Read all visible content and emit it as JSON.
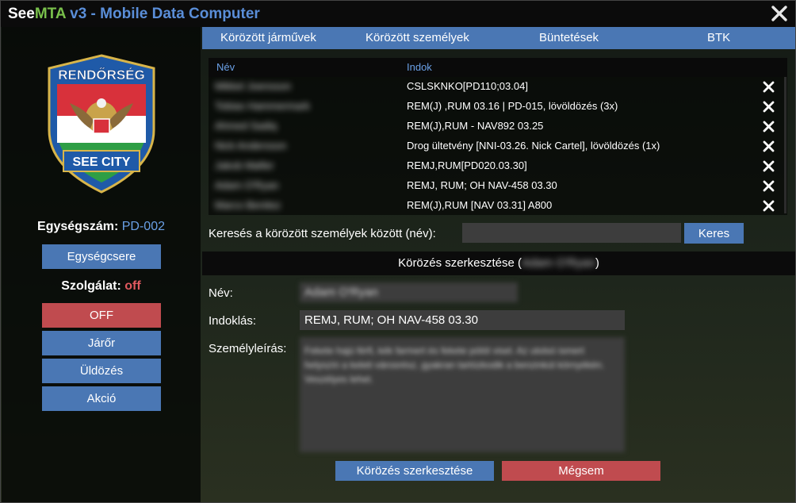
{
  "window": {
    "title_part1": "See",
    "title_part2": "MTA",
    "title_part3": " v3 - Mobile Data Computer"
  },
  "sidebar": {
    "badge": {
      "top_text": "RENDŐRSÉG",
      "bottom_text": "SEE CITY"
    },
    "unit_label": "Egységszám:",
    "unit_value": "PD-002",
    "unit_change_button": "Egységcsere",
    "duty_label": "Szolgálat:",
    "duty_value": "off",
    "status_buttons": [
      "OFF",
      "Járőr",
      "Üldözés",
      "Akció"
    ]
  },
  "tabs": [
    "Körözött járművek",
    "Körözött személyek",
    "Büntetések",
    "BTK"
  ],
  "table": {
    "columns": [
      "Név",
      "Indok"
    ],
    "rows": [
      {
        "name": "Mikkel Joensson",
        "reason": "CSLSKNKO[PD110;03.04]"
      },
      {
        "name": "Tobias Hammermark",
        "reason": "REM(J) ,RUM 03.16 | PD-015, lövöldözés (3x)"
      },
      {
        "name": "Ahmed Sadiq",
        "reason": "REM(J),RUM - NAV892 03.25"
      },
      {
        "name": "Nick Andersson",
        "reason": "Drog ültetvény [NNI-03.26. Nick Cartel], lövöldözés (1x)"
      },
      {
        "name": "Jakob Møller",
        "reason": "REMJ,RUM[PD020.03.30]"
      },
      {
        "name": "Adam O'Ryan",
        "reason": "REMJ, RUM; OH NAV-458 03.30"
      },
      {
        "name": "Marco Benitez",
        "reason": "REM(J),RUM [NAV 03.31] A800"
      }
    ]
  },
  "search": {
    "label": "Keresés a körözött személyek között (név):",
    "value": "",
    "button": "Keres"
  },
  "edit": {
    "header_prefix": "Körözés szerkesztése (",
    "header_name": "Adam O'Ryan",
    "header_suffix": ")",
    "name_label": "Név:",
    "name_value": "Adam O'Ryan",
    "reason_label": "Indoklás:",
    "reason_value": "REMJ, RUM; OH NAV-458 03.30",
    "description_label": "Személyleírás:",
    "description_value": "Fekete hajú férfi, kék farmert és fekete pólót visel. Az utolsó ismert helyszín a keleti városrész, gyakran tartózkodik a benzinkút környékén. Veszélyes lehet.",
    "save_button": "Körözés szerkesztése",
    "cancel_button": "Mégsem"
  },
  "colors": {
    "accent_blue": "#4a77b4",
    "accent_red": "#c04b4f",
    "mta_green": "#79c04b",
    "title_blue": "#5a8ed8",
    "highlight_blue": "#6aa0e6",
    "duty_red": "#e0595f"
  }
}
